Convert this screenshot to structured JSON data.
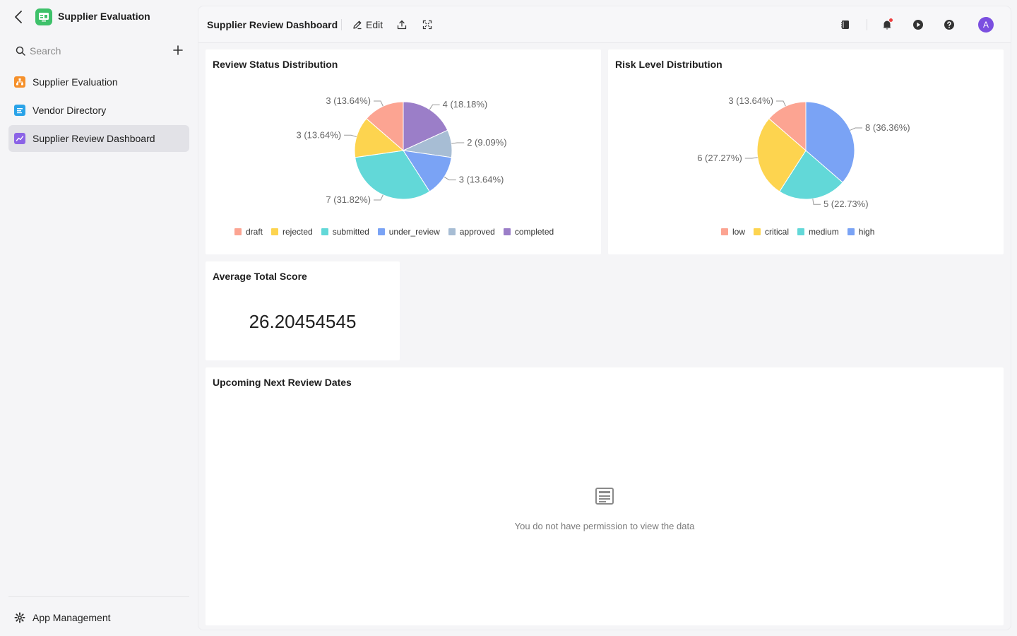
{
  "sidebar": {
    "app_name": "Supplier Evaluation",
    "search_placeholder": "Search",
    "items": [
      {
        "label": "Supplier Evaluation",
        "color": "#f5902b"
      },
      {
        "label": "Vendor Directory",
        "color": "#2aa3e8"
      },
      {
        "label": "Supplier Review Dashboard",
        "color": "#8b63e6"
      }
    ],
    "footer_label": "App Management"
  },
  "toolbar": {
    "title": "Supplier Review Dashboard",
    "edit_label": "Edit",
    "avatar_initial": "A"
  },
  "cards": {
    "review_status_title": "Review Status Distribution",
    "risk_level_title": "Risk Level Distribution",
    "avg_score_title": "Average Total Score",
    "avg_score_value": "26.20454545",
    "upcoming_title": "Upcoming Next Review Dates",
    "upcoming_empty": "You do not have permission to view the data"
  },
  "chart_data": [
    {
      "type": "pie",
      "title": "Review Status Distribution",
      "legend_position": "bottom",
      "slices": [
        {
          "name": "completed",
          "value": 4,
          "label": "4 (18.18%)",
          "color": "#9b7ec8"
        },
        {
          "name": "approved",
          "value": 2,
          "label": "2 (9.09%)",
          "color": "#a7bdd4"
        },
        {
          "name": "under_review",
          "value": 3,
          "label": "3 (13.64%)",
          "color": "#7aa3f5"
        },
        {
          "name": "submitted",
          "value": 7,
          "label": "7 (31.82%)",
          "color": "#62d8d8"
        },
        {
          "name": "rejected",
          "value": 3,
          "label": "3 (13.64%)",
          "color": "#fdd44f"
        },
        {
          "name": "draft",
          "value": 3,
          "label": "3 (13.64%)",
          "color": "#fca492"
        }
      ],
      "legend_order": [
        "draft",
        "rejected",
        "submitted",
        "under_review",
        "approved",
        "completed"
      ]
    },
    {
      "type": "pie",
      "title": "Risk Level Distribution",
      "legend_position": "bottom",
      "slices": [
        {
          "name": "high",
          "value": 8,
          "label": "8 (36.36%)",
          "color": "#7aa3f5"
        },
        {
          "name": "medium",
          "value": 5,
          "label": "5 (22.73%)",
          "color": "#62d8d8"
        },
        {
          "name": "critical",
          "value": 6,
          "label": "6 (27.27%)",
          "color": "#fdd44f"
        },
        {
          "name": "low",
          "value": 3,
          "label": "3 (13.64%)",
          "color": "#fca492"
        }
      ],
      "legend_order": [
        "low",
        "critical",
        "medium",
        "high"
      ]
    }
  ]
}
